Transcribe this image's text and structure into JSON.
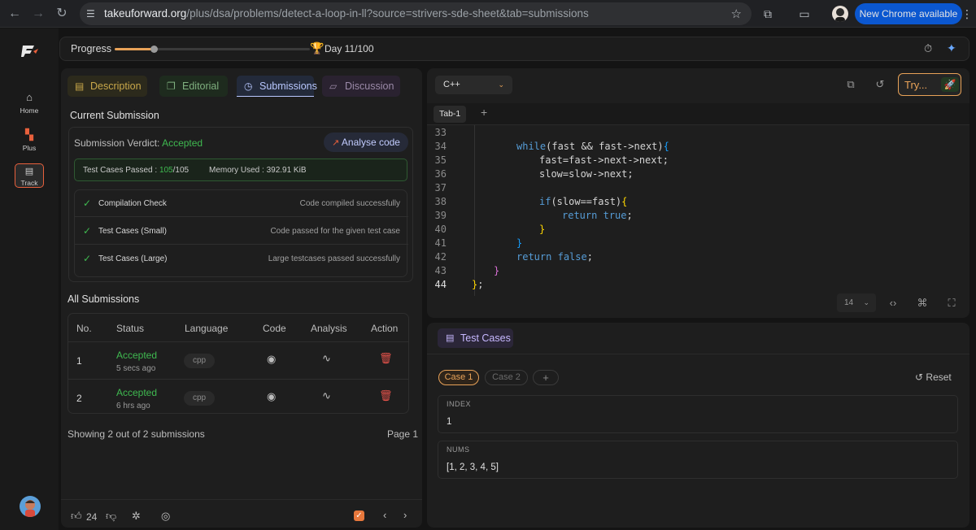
{
  "browser": {
    "url_host": "takeuforward.org",
    "url_path": "/plus/dsa/problems/detect-a-loop-in-ll?source=strivers-sde-sheet&tab=submissions",
    "new_chrome_label": "New Chrome available"
  },
  "rail": {
    "items": [
      {
        "label": "Home"
      },
      {
        "label": "Plus"
      },
      {
        "label": "Track"
      }
    ]
  },
  "progress": {
    "label": "Progress",
    "value_fraction": 0.2,
    "day_label": "Day 11/100"
  },
  "left_tabs": [
    {
      "label": "Description"
    },
    {
      "label": "Editorial"
    },
    {
      "label": "Submissions"
    },
    {
      "label": "Discussion"
    }
  ],
  "current_submission": {
    "heading": "Current Submission",
    "verdict_label": "Submission Verdict:",
    "verdict_value": "Accepted",
    "analyse_label": "Analyse code",
    "tests_label": "Test Cases Passed :",
    "tests_passed": "105",
    "tests_total": "/105",
    "memory_label": "Memory Used : 392.91 KiB",
    "checks": [
      {
        "name": "Compilation Check",
        "desc": "Code compiled successfully"
      },
      {
        "name": "Test Cases (Small)",
        "desc": "Code passed for the given test case"
      },
      {
        "name": "Test Cases (Large)",
        "desc": "Large testcases passed successfully"
      }
    ]
  },
  "all_submissions": {
    "heading": "All Submissions",
    "columns": [
      "No.",
      "Status",
      "Language",
      "Code",
      "Analysis",
      "Action"
    ],
    "rows": [
      {
        "no": "1",
        "status": "Accepted",
        "time": "5 secs ago",
        "lang": "cpp"
      },
      {
        "no": "2",
        "status": "Accepted",
        "time": "6 hrs ago",
        "lang": "cpp"
      }
    ],
    "footer": "Showing 2 out of 2 submissions",
    "page": "Page 1"
  },
  "bottom_bar": {
    "likes": "24"
  },
  "editor": {
    "language": "C++",
    "try_label": "Try...",
    "tab_label": "Tab-1",
    "font_size": "14",
    "lines": [
      {
        "n": "33"
      },
      {
        "n": "34"
      },
      {
        "n": "35"
      },
      {
        "n": "36"
      },
      {
        "n": "37"
      },
      {
        "n": "38"
      },
      {
        "n": "39"
      },
      {
        "n": "40"
      },
      {
        "n": "41"
      },
      {
        "n": "42"
      },
      {
        "n": "43"
      },
      {
        "n": "44"
      }
    ]
  },
  "testcases": {
    "title": "Test Cases",
    "cases": [
      "Case 1",
      "Case 2"
    ],
    "add": "+",
    "reset_label": "Reset",
    "fields": [
      {
        "label": "INDEX",
        "value": "1"
      },
      {
        "label": "NUMS",
        "value": "[1, 2, 3, 4, 5]"
      }
    ]
  },
  "colors": {
    "accent": "#e8a258",
    "accepted": "#3fb950",
    "delete": "#e5534b",
    "active_tab": "#b9c8ff"
  }
}
